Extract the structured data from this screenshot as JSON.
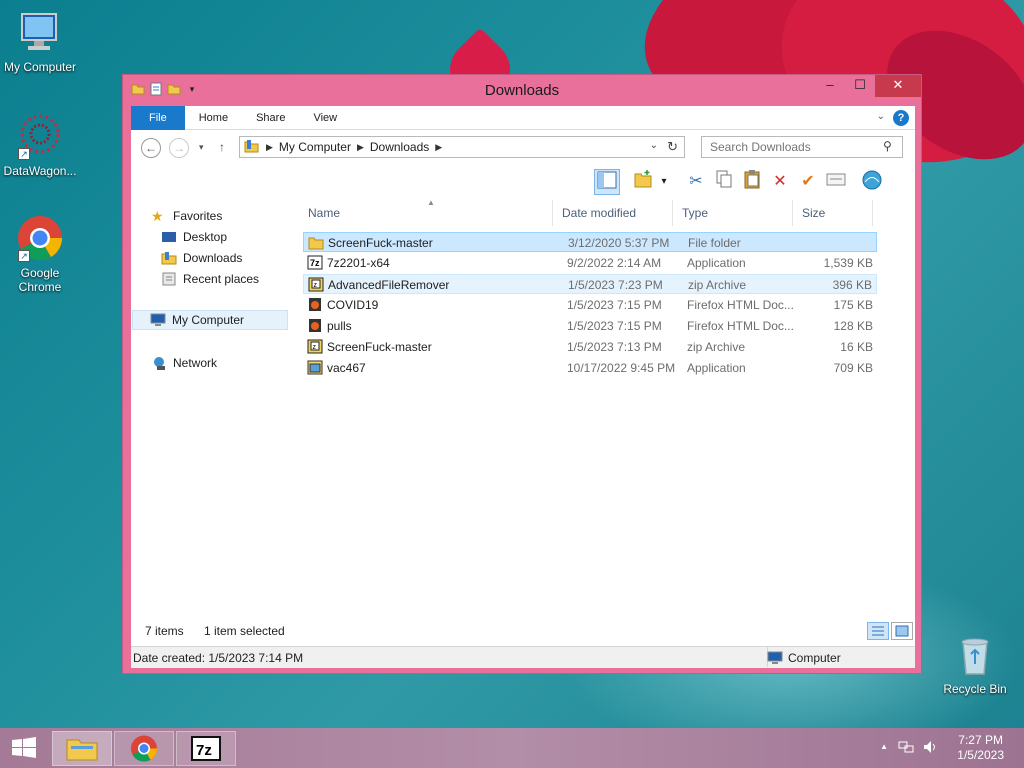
{
  "desktop": {
    "icons": [
      {
        "label": "My Computer"
      },
      {
        "label": "DataWagon..."
      },
      {
        "label": "Google Chrome"
      },
      {
        "label": "Recycle Bin"
      }
    ]
  },
  "window": {
    "title": "Downloads",
    "controls": {
      "minimize": "–",
      "maximize": "☐",
      "close": "✕"
    }
  },
  "ribbon": {
    "tabs": [
      "File",
      "Home",
      "Share",
      "View"
    ],
    "help": "?"
  },
  "navigation": {
    "breadcrumb": [
      "My Computer",
      "Downloads"
    ],
    "search_placeholder": "Search Downloads"
  },
  "nav_pane": {
    "favorites": "Favorites",
    "favorite_items": [
      "Desktop",
      "Downloads",
      "Recent places"
    ],
    "computer": "My Computer",
    "network": "Network"
  },
  "file_list": {
    "columns": [
      "Name",
      "Date modified",
      "Type",
      "Size"
    ],
    "rows": [
      {
        "name": "ScreenFuck-master",
        "date": "3/12/2020 5:37 PM",
        "type": "File folder",
        "size": "",
        "icon": "folder-icon"
      },
      {
        "name": "7z2201-x64",
        "date": "9/2/2022 2:14 AM",
        "type": "Application",
        "size": "1,539 KB",
        "icon": "7zip-icon"
      },
      {
        "name": "AdvancedFileRemover",
        "date": "1/5/2023 7:23 PM",
        "type": "zip Archive",
        "size": "396 KB",
        "icon": "zip-icon"
      },
      {
        "name": "COVID19",
        "date": "1/5/2023 7:15 PM",
        "type": "Firefox HTML Doc...",
        "size": "175 KB",
        "icon": "firefox-html-icon"
      },
      {
        "name": "pulls",
        "date": "1/5/2023 7:15 PM",
        "type": "Firefox HTML Doc...",
        "size": "128 KB",
        "icon": "firefox-html-icon"
      },
      {
        "name": "ScreenFuck-master",
        "date": "1/5/2023 7:13 PM",
        "type": "zip Archive",
        "size": "16 KB",
        "icon": "zip-icon"
      },
      {
        "name": "vac467",
        "date": "10/17/2022 9:45 PM",
        "type": "Application",
        "size": "709 KB",
        "icon": "app-icon"
      }
    ]
  },
  "status": {
    "items_count": "7 items",
    "selection": "1 item selected",
    "date_created": "Date created: 1/5/2023 7:14 PM",
    "location": "Computer"
  },
  "taskbar": {
    "clock_time": "7:27 PM",
    "clock_date": "1/5/2023",
    "tray_up": "▲"
  },
  "colors": {
    "window_frame": "#e8709a",
    "file_tab": "#1979ca",
    "selection": "#cce8ff"
  }
}
